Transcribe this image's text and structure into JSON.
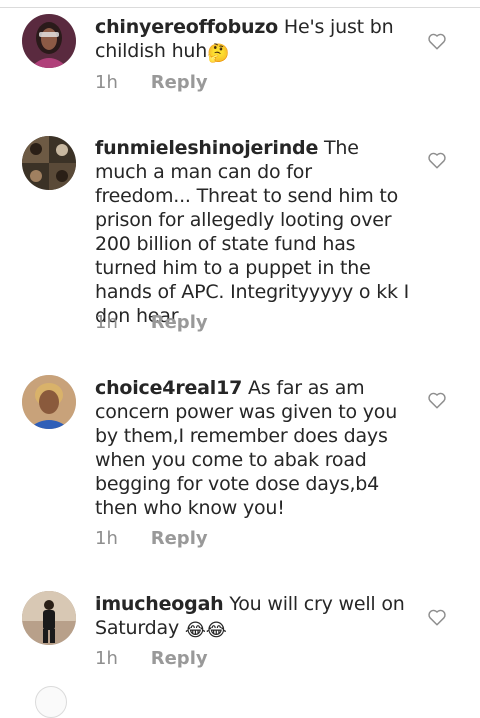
{
  "comments": [
    {
      "username": "chinyereoffobuzo",
      "text": "He's just bn childish huh",
      "emoji": "🤔",
      "time": "1h",
      "reply_label": "Reply"
    },
    {
      "username": "funmieleshinojerinde",
      "text": "The much a man can do for freedom... Threat to send him to prison for allegedly looting over 200 billion of state fund has turned him to a puppet in the hands of APC. Integrityyyyy o kk I don hear",
      "time": "1h",
      "reply_label": "Reply"
    },
    {
      "username": "choice4real17",
      "text": "As far as am concern power was given to you by them,I remember does days when you come to abak road begging for vote dose days,b4 then who know you!",
      "time": "1h",
      "reply_label": "Reply"
    },
    {
      "username": "imucheogah",
      "text": "You will cry well on Saturday",
      "emoji": "😂😂",
      "time": "1h",
      "reply_label": "Reply"
    }
  ],
  "icons": {
    "like": "heart-outline-icon",
    "avatar": "profile-photo"
  },
  "colors": {
    "text": "#262626",
    "muted": "#8e8e8e",
    "divider": "#dbdbdb"
  }
}
